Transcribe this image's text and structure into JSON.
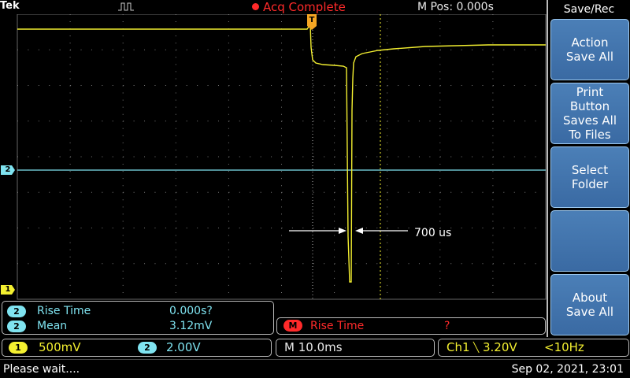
{
  "header": {
    "brand": "Tek",
    "acq_status": "Acq Complete",
    "m_pos": "M Pos: 0.000s"
  },
  "colors": {
    "ch1": "#f3ef30",
    "ch2": "#7fe3f0",
    "math": "#ff2a2a",
    "trigger": "#f5a623",
    "menu_button": "#4b7fb7"
  },
  "icons": {
    "run": "run-state-icon",
    "acq": "acq-dot-icon"
  },
  "markers": {
    "ch1": "1",
    "ch2": "2",
    "trigger": "T"
  },
  "annotation": {
    "text": "700 us"
  },
  "measurements": [
    {
      "channel": "2",
      "label": "Rise Time",
      "value": "0.000s?"
    },
    {
      "channel": "2",
      "label": "Mean",
      "value": "3.12mV"
    }
  ],
  "math_measurement": {
    "channel": "M",
    "label": "Rise Time",
    "value": "?"
  },
  "channels": {
    "ch1": {
      "badge": "1",
      "scale": "500mV"
    },
    "ch2": {
      "badge": "2",
      "scale": "2.00V"
    }
  },
  "timebase": "M 10.0ms",
  "trigger": {
    "source": "Ch1",
    "slope_icon": "╲",
    "level": "3.20V",
    "frequency": "<10Hz"
  },
  "status": {
    "message": "Please wait....",
    "datetime": "Sep 02, 2021, 23:01"
  },
  "side_menu": {
    "title": "Save/Rec",
    "buttons": [
      "Action\nSave All",
      "Print\nButton\nSaves All\nTo Files",
      "Select\nFolder",
      "",
      "About\nSave All"
    ]
  }
}
